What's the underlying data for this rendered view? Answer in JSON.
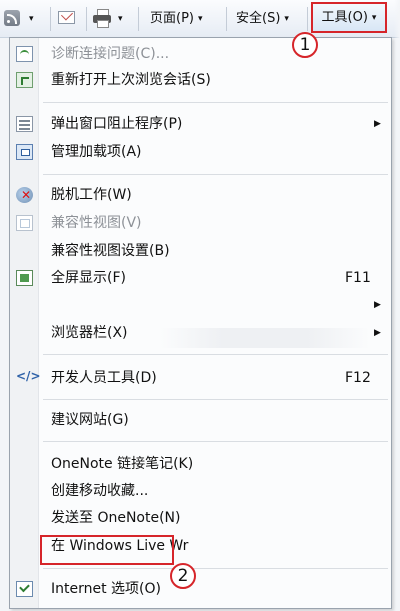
{
  "toolbar": {
    "feeds_icon": "rss-icon",
    "mail_icon": "mail-icon",
    "print_icon": "printer-icon",
    "page_label": "页面(P)",
    "safety_label": "安全(S)",
    "tools_label": "工具(O)",
    "arrow": "▾"
  },
  "annotations": {
    "marker1": "1",
    "marker2": "2",
    "highlight_color": "#d6252a"
  },
  "menu": {
    "diagnose": "诊断连接问题(C)...",
    "reopen_session": "重新打开上次浏览会话(S)",
    "popup_blocker": "弹出窗口阻止程序(P)",
    "manage_addons": "管理加载项(A)",
    "work_offline": "脱机工作(W)",
    "compat_view": "兼容性视图(V)",
    "compat_settings": "兼容性视图设置(B)",
    "full_screen": "全屏显示(F)",
    "full_screen_shortcut": "F11",
    "browser_bars": "浏览器栏(X)",
    "dev_tools": "开发人员工具(D)",
    "dev_tools_shortcut": "F12",
    "suggested_sites": "建议网站(G)",
    "onenote_linked": "OneNote 链接笔记(K)",
    "create_mobile_favorite": "创建移动收藏...",
    "send_to_onenote": "发送至 OneNote(N)",
    "windows_live": "在 Windows Live Wr",
    "internet_options": "Internet 选项(O)",
    "submenu_arrow": "▶"
  }
}
